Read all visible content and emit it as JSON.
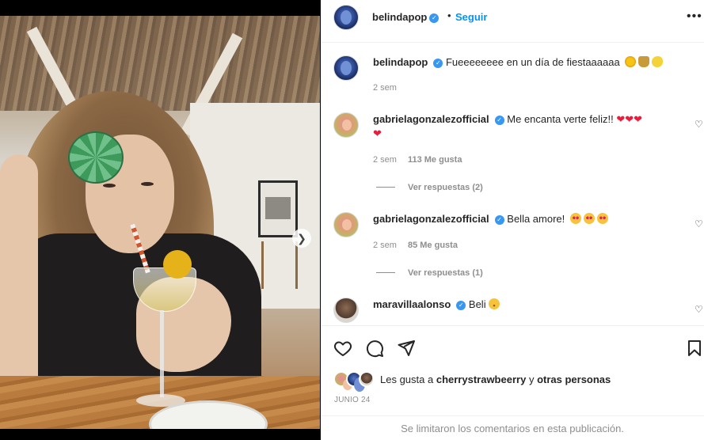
{
  "post": {
    "author": "belindapop",
    "follow_label": "Seguir",
    "dot": "•",
    "more": "•••"
  },
  "caption": {
    "username": "belindapop",
    "text": "Fueeeeeeee en un día de fiestaaaaaa",
    "time": "2 sem"
  },
  "comments": [
    {
      "username": "gabrielagonzalezofficial",
      "text": "Me encanta verte feliz!!",
      "time": "2 sem",
      "likes": "113 Me gusta",
      "replies": "Ver respuestas (2)"
    },
    {
      "username": "gabrielagonzalezofficial",
      "text": "Bella amore!",
      "time": "2 sem",
      "likes": "85 Me gusta",
      "replies": "Ver respuestas (1)"
    },
    {
      "username": "maravillaalonso",
      "text": "Beli"
    }
  ],
  "likes": {
    "prefix": "Les gusta a",
    "user": "cherrystrawbeerry",
    "join": "y",
    "others": "otras personas"
  },
  "date": "JUNIO 24",
  "comments_closed": "Se limitaron los comentarios en esta publicación.",
  "icons": [
    "heart-icon",
    "comment-icon",
    "share-icon",
    "bookmark-icon",
    "more-icon",
    "verified-icon",
    "chevron-right-icon"
  ],
  "colors": {
    "link_blue": "#0095f6",
    "verified_blue": "#3897f0",
    "heart_red": "#ed1c3c",
    "muted": "#8e8e8e"
  }
}
